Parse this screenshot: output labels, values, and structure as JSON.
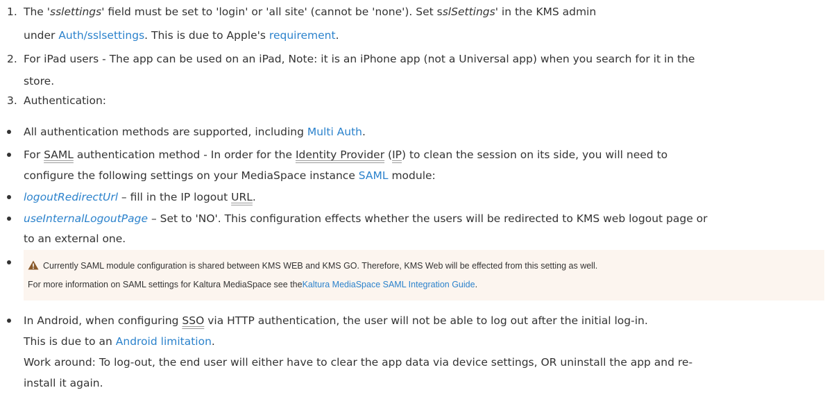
{
  "item1": {
    "number": "1.",
    "t1": "The  '",
    "field": "sslettings",
    "t2": "' field must be set to 'login' or 'all site' (cannot be 'none'). Set s",
    "setting": "slSettings",
    "t3": "' in the KMS admin",
    "t4": "under ",
    "auth_link": "Auth/sslsettings",
    "t5": ". This is due to Apple's ",
    "req_link": "requirement",
    "t6": "."
  },
  "item2": {
    "number": "2.",
    "line1": "For iPad users - The app can be used on an iPad, Note: it is an iPhone app (not a Universal app) when you search for it in the",
    "line2": "store."
  },
  "item3": {
    "number": "3.",
    "text": "Authentication:"
  },
  "b1": {
    "t1": "All authentication methods are supported, including ",
    "link": "Multi Auth",
    "t2": "."
  },
  "b2": {
    "t1": "For ",
    "saml": "SAML",
    "t2": " authentication method - In order for the ",
    "idp": "Identity Provider",
    "t3": " (",
    "ip": "IP",
    "t4": ") to clean the session on its side, you will need to",
    "t5": "configure the following settings on your MediaSpace instance ",
    "saml_link": "SAML",
    "t6": " module:"
  },
  "b3": {
    "link": "logoutRedirectUrl",
    "t1": " – fill in the IP logout ",
    "url": "URL",
    "t2": "."
  },
  "b4": {
    "link": "useInternalLogoutPage",
    "t1": " – Set to 'NO'. This configuration effects whether the users will be redirected to KMS web logout page or",
    "t2": "to an external one."
  },
  "note": {
    "line1": "Currently SAML module configuration is shared between KMS WEB and KMS GO. Therefore, KMS Web will be effected from this setting as well.",
    "line2": "For more information on SAML settings for Kaltura MediaSpace see the",
    "link": "Kaltura MediaSpace SAML Integration Guide",
    "end": ".",
    "icon": "warning-icon",
    "icon_color": "#8a5a2b",
    "bg": "#fcf5ef"
  },
  "b5": {
    "t1": "In Android, when configuring ",
    "sso": "SSO",
    "t2": " via HTTP authentication, the user will not be able to log out after the initial log-in.",
    "t3": "This is due to an ",
    "link": "Android limitation",
    "t4": ".",
    "t5": "Work around: To log-out, the end user will either have to clear the app data via device settings, OR uninstall the app and re-",
    "t6": "install it again."
  },
  "colors": {
    "text": "#333333",
    "link": "#2b82cc"
  }
}
